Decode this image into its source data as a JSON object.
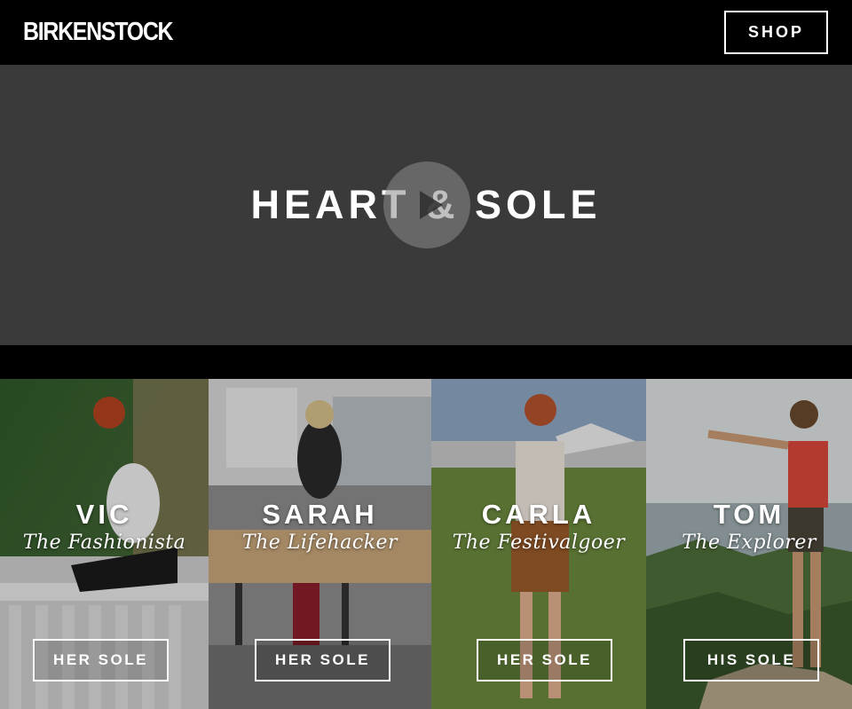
{
  "header": {
    "logo": "BIRKENSTOCK",
    "shop_label": "SHOP"
  },
  "hero": {
    "title": "HEART & SOLE",
    "play_icon": "play-icon"
  },
  "cards": [
    {
      "name": "VIC",
      "role": "The Fashionista",
      "button": "HER SOLE"
    },
    {
      "name": "SARAH",
      "role": "The Lifehacker",
      "button": "HER SOLE"
    },
    {
      "name": "CARLA",
      "role": "The Festivalgoer",
      "button": "HER SOLE"
    },
    {
      "name": "TOM",
      "role": "The Explorer",
      "button": "HIS SOLE"
    }
  ],
  "colors": {
    "header_bg": "#000000",
    "hero_bg": "#3a3a3a",
    "text": "#ffffff"
  }
}
